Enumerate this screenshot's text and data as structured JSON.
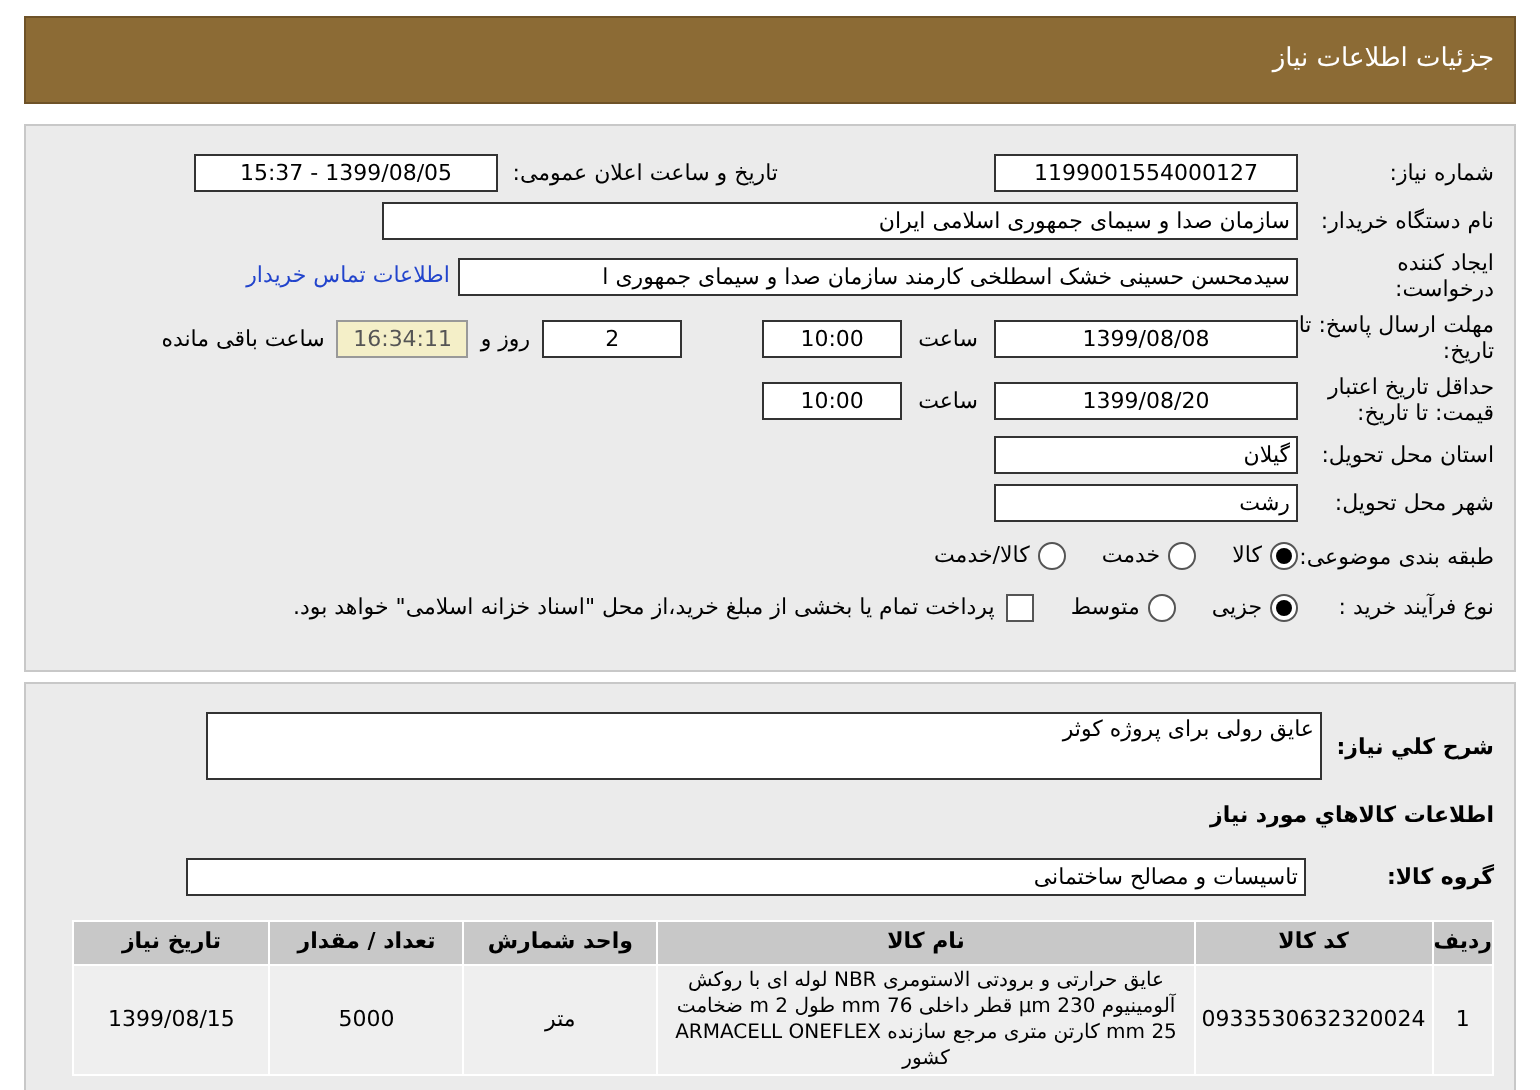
{
  "header": {
    "title": "جزئیات اطلاعات نیاز"
  },
  "need_number": {
    "label": "شماره نیاز:",
    "value": "1199001554000127"
  },
  "announce": {
    "label": "تاریخ و ساعت اعلان عمومی:",
    "value": "1399/08/05 - 15:37"
  },
  "buyer": {
    "label": "نام دستگاه خریدار:",
    "value": "سازمان صدا و سیمای جمهوری اسلامی ایران"
  },
  "requester": {
    "label": "ایجاد کننده درخواست:",
    "value": "سیدمحسن حسینی خشک اسطلخی کارمند سازمان صدا و سیمای جمهوری ا",
    "link": "اطلاعات تماس خریدار"
  },
  "deadline": {
    "label": "مهلت ارسال پاسخ: تا تاریخ:",
    "date": "1399/08/08",
    "time_label": "ساعت",
    "time": "10:00",
    "days": "2",
    "days_label": "روز و",
    "remaining": "16:34:11",
    "remaining_label": "ساعت باقی مانده"
  },
  "validity": {
    "label": "حداقل تاریخ اعتبار قیمت: تا تاریخ:",
    "date": "1399/08/20",
    "time_label": "ساعت",
    "time": "10:00"
  },
  "province": {
    "label": "استان محل تحویل:",
    "value": "گیلان"
  },
  "city": {
    "label": "شهر محل تحویل:",
    "value": "رشت"
  },
  "category": {
    "label": "طبقه بندی موضوعی:",
    "options": [
      {
        "label": "کالا",
        "selected": true
      },
      {
        "label": "خدمت",
        "selected": false
      },
      {
        "label": "کالا/خدمت",
        "selected": false
      }
    ]
  },
  "process": {
    "label": "نوع فرآیند خرید :",
    "options": [
      {
        "label": "جزیی",
        "selected": true
      },
      {
        "label": "متوسط",
        "selected": false
      }
    ],
    "checkbox": {
      "label": "پرداخت تمام یا بخشی از مبلغ خرید،از محل \"اسناد خزانه اسلامی\" خواهد بود.",
      "checked": false
    }
  },
  "description": {
    "label": "شرح کلي نياز:",
    "value": "عایق رولی برای پروژه کوثر"
  },
  "goods_title": "اطلاعات کالاهاي مورد نياز",
  "group": {
    "label": "گروه کالا:",
    "value": "تاسیسات و مصالح ساختمانی"
  },
  "table": {
    "columns": [
      "ردیف",
      "کد کالا",
      "نام کالا",
      "واحد شمارش",
      "تعداد / مقدار",
      "تاریخ نیاز"
    ],
    "rows": [
      [
        "1",
        "0933530632320024",
        "عایق حرارتی و برودتی الاستومری NBR لوله ای با روکش آلومینیوم 230 µm قطر داخلی 76 mm طول 2 m ضخامت 25 mm کارتن متری مرجع سازنده ARMACELL ONEFLEX کشور",
        "متر",
        "5000",
        "1399/08/15"
      ]
    ]
  }
}
